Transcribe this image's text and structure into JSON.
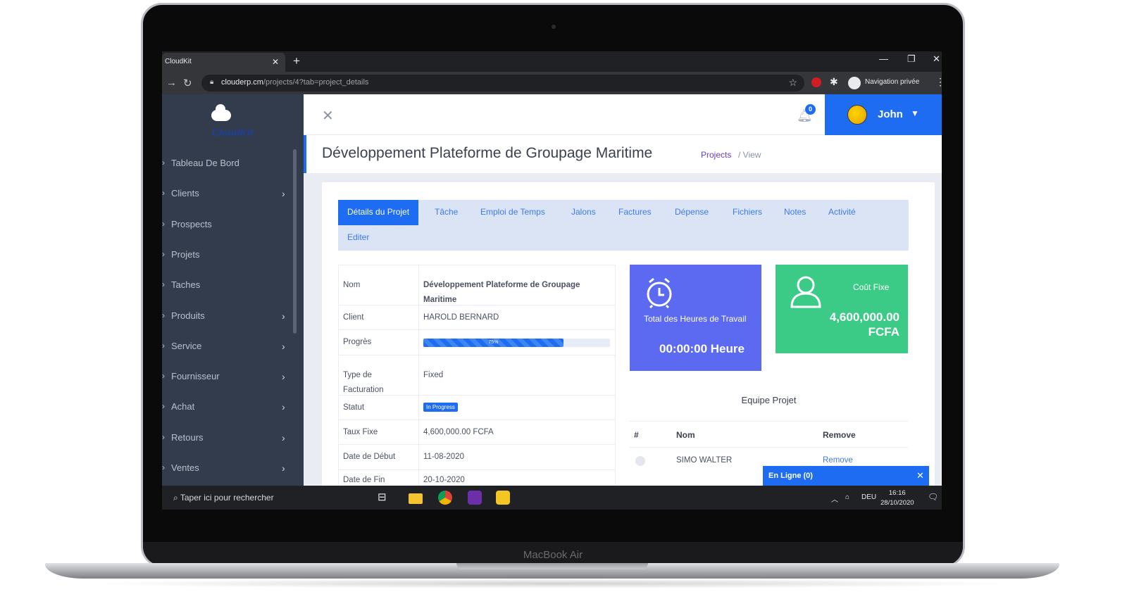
{
  "device": {
    "brand": "MacBook Air"
  },
  "browser": {
    "tab_title": "CloudKit",
    "url_host": "clouderp.cm",
    "url_path": "/projects/4?tab=project_details",
    "profile_label": "Navigation privée"
  },
  "sidebar": {
    "logo_text": "CloudKit",
    "items": [
      {
        "label": "Tableau De Bord",
        "has_children": false
      },
      {
        "label": "Clients",
        "has_children": true
      },
      {
        "label": "Prospects",
        "has_children": false
      },
      {
        "label": "Projets",
        "has_children": false
      },
      {
        "label": "Taches",
        "has_children": false
      },
      {
        "label": "Produits",
        "has_children": true
      },
      {
        "label": "Service",
        "has_children": true
      },
      {
        "label": "Fournisseur",
        "has_children": true
      },
      {
        "label": "Achat",
        "has_children": true
      },
      {
        "label": "Retours",
        "has_children": true
      },
      {
        "label": "Ventes",
        "has_children": true
      }
    ]
  },
  "topbar": {
    "notification_count": "0",
    "user_name": "John",
    "accent_color": "#1d6cf2"
  },
  "page": {
    "title": "Développement Plateforme de Groupage Maritime",
    "breadcrumb": {
      "link": "Projects",
      "current": "View"
    }
  },
  "tabs": [
    "Détails du Projet",
    "Tâche",
    "Emploi de Temps",
    "Jalons",
    "Factures",
    "Dépense",
    "Fichiers",
    "Notes",
    "Activité",
    "Editer"
  ],
  "details": {
    "rows": [
      {
        "key": "Nom",
        "value": "Développement Plateforme de Groupage Maritime"
      },
      {
        "key": "Client",
        "value": "HAROLD BERNARD"
      },
      {
        "key": "Progrès",
        "value": "75%",
        "progress": 0.75
      },
      {
        "key": "Type de Facturation",
        "value": "Fixed"
      },
      {
        "key": "Statut",
        "value": "In Progress"
      },
      {
        "key": "Taux Fixe",
        "value": "4,600,000.00 FCFA"
      },
      {
        "key": "Date de Début",
        "value": "11-08-2020"
      },
      {
        "key": "Date de Fin",
        "value": "20-10-2020"
      }
    ]
  },
  "stats": {
    "hours": {
      "label": "Total des Heures de Travail",
      "value": "00:00:00 Heure",
      "color": "#5b6af0",
      "icon": "alarm-clock-icon"
    },
    "cost": {
      "label": "Coût Fixe",
      "value": "4,600,000.00 FCFA",
      "color": "#3ccb86",
      "icon": "user-icon"
    }
  },
  "team": {
    "title": "Equipe Projet",
    "columns": [
      "#",
      "Nom",
      "Remove"
    ],
    "rows": [
      {
        "name": "SIMO WALTER",
        "action": "Remove"
      }
    ]
  },
  "chat": {
    "label": "En Ligne (0)"
  },
  "taskbar": {
    "search_placeholder": "Taper ici pour rechercher",
    "language": "DEU",
    "time": "16:16",
    "date": "28/10/2020"
  }
}
